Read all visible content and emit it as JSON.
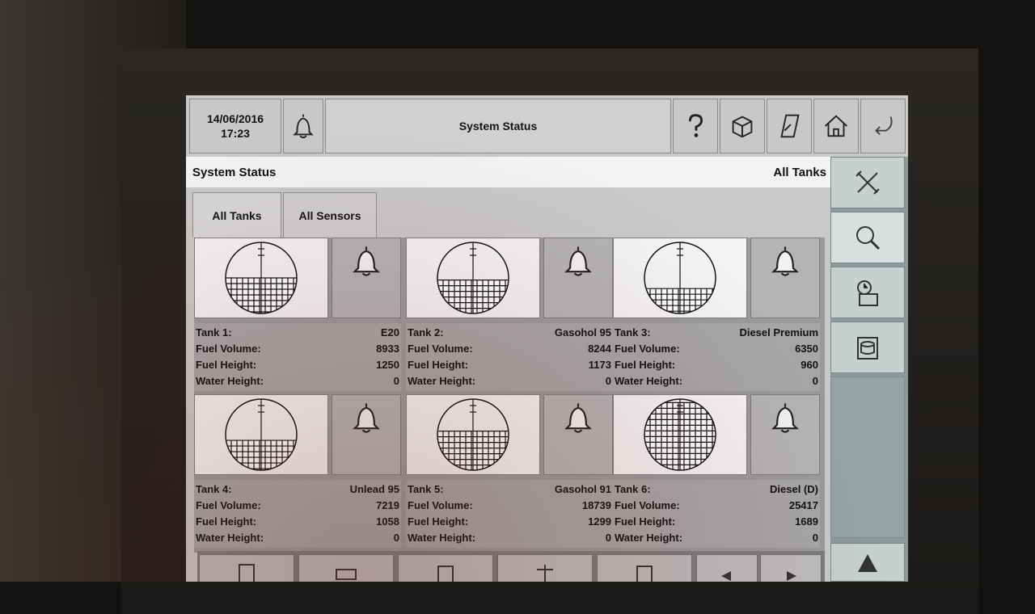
{
  "header": {
    "date": "14/06/2016",
    "time": "17:23",
    "title": "System Status",
    "icons": [
      "bell-icon",
      "help-icon",
      "package-icon",
      "note-icon",
      "home-icon",
      "back-icon"
    ]
  },
  "page": {
    "title": "System Status",
    "scope": "All Tanks"
  },
  "tabs": [
    {
      "label": "All Tanks",
      "selected": true
    },
    {
      "label": "All Sensors",
      "selected": false
    }
  ],
  "labels": {
    "fuel_volume": "Fuel Volume:",
    "fuel_height": "Fuel Height:",
    "water_height": "Water Height:"
  },
  "tanks": [
    {
      "name": "Tank 1:",
      "product": "E20",
      "fuel_volume": "8933",
      "fuel_height": "1250",
      "water_height": "0",
      "fill_level": 0.5
    },
    {
      "name": "Tank 2:",
      "product": "Gasohol 95",
      "fuel_volume": "8244",
      "fuel_height": "1173",
      "water_height": "0",
      "fill_level": 0.47
    },
    {
      "name": "Tank 3:",
      "product": "Diesel Premium",
      "fuel_volume": "6350",
      "fuel_height": "960",
      "water_height": "0",
      "fill_level": 0.35
    },
    {
      "name": "Tank 4:",
      "product": "Unlead 95",
      "fuel_volume": "7219",
      "fuel_height": "1058",
      "water_height": "0",
      "fill_level": 0.42
    },
    {
      "name": "Tank 5:",
      "product": "Gasohol 91",
      "fuel_volume": "18739",
      "fuel_height": "1299",
      "water_height": "0",
      "fill_level": 0.55
    },
    {
      "name": "Tank 6:",
      "product": "Diesel (D)",
      "fuel_volume": "25417",
      "fuel_height": "1689",
      "water_height": "0",
      "fill_level": 0.95
    }
  ],
  "sidebar": {
    "icons": [
      "tools-icon",
      "search-icon",
      "clock-report-icon",
      "database-icon",
      "scroll-up-icon"
    ]
  },
  "bottom_bar": {
    "icons": [
      "document-icon",
      "truck-icon",
      "delivery-icon",
      "scale-icon",
      "scale-report-icon",
      "arrow-left-icon",
      "arrow-right-icon"
    ]
  }
}
